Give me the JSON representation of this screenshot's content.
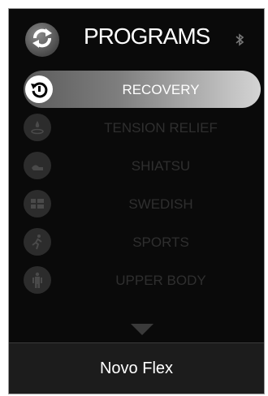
{
  "header": {
    "title": "PROGRAMS",
    "sync_icon": "sync-icon",
    "bluetooth_icon": "bluetooth-icon"
  },
  "programs": [
    {
      "label": "RECOVERY",
      "icon": "reset-icon",
      "active": true
    },
    {
      "label": "TENSION RELIEF",
      "icon": "water-drop-icon",
      "active": false
    },
    {
      "label": "SHIATSU",
      "icon": "hand-icon",
      "active": false
    },
    {
      "label": "SWEDISH",
      "icon": "swedish-flag-icon",
      "active": false
    },
    {
      "label": "SPORTS",
      "icon": "runner-icon",
      "active": false
    },
    {
      "label": "UPPER BODY",
      "icon": "person-icon",
      "active": false
    }
  ],
  "scroll": {
    "icon": "chevron-down-icon"
  },
  "footer": {
    "brand": "Novo Flex"
  },
  "colors": {
    "background": "#0a0a0a",
    "active_text": "#ffffff",
    "inactive_text": "#2f2f2f",
    "footer_bg": "#1c1c1c"
  }
}
